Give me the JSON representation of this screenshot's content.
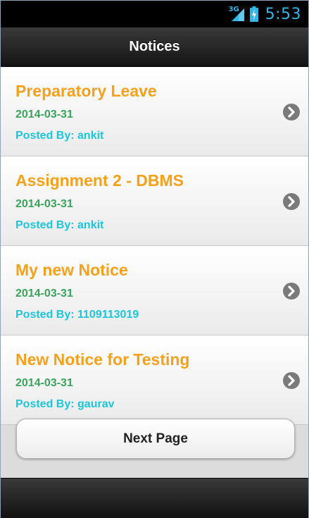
{
  "status_bar": {
    "network_label": "3G",
    "time": "5:53",
    "accent_color": "#33b5e5",
    "icons": [
      "signal-3g-icon",
      "battery-charging-icon"
    ]
  },
  "header": {
    "title": "Notices"
  },
  "notices": [
    {
      "title": "Preparatory Leave",
      "date": "2014-03-31",
      "posted_by": "Posted By: ankit"
    },
    {
      "title": "Assignment 2 - DBMS",
      "date": "2014-03-31",
      "posted_by": "Posted By: ankit"
    },
    {
      "title": "My new Notice",
      "date": "2014-03-31",
      "posted_by": "Posted By: 1109113019"
    },
    {
      "title": "New Notice for Testing",
      "date": "2014-03-31",
      "posted_by": "Posted By: gaurav"
    }
  ],
  "colors": {
    "title": "#f5a11b",
    "date": "#3aa35c",
    "poster": "#1cc6da"
  },
  "next_button": {
    "label": "Next Page"
  }
}
